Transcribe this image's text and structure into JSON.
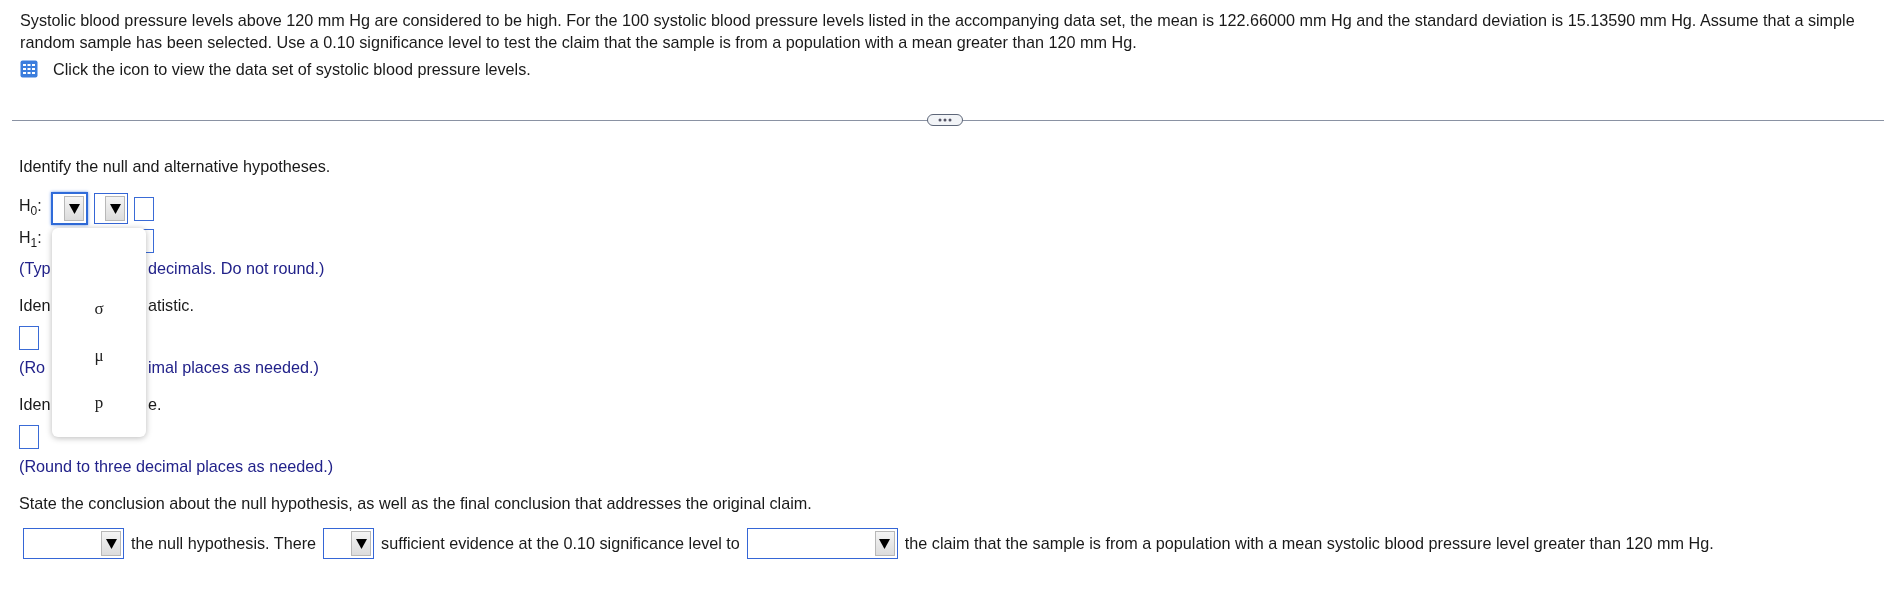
{
  "problem": {
    "text": "Systolic blood pressure levels above 120 mm Hg are considered to be high. For the 100 systolic blood pressure levels listed in the accompanying data set, the mean is 122.66000 mm Hg and the standard deviation is 15.13590 mm Hg. Assume that a simple random sample has been selected. Use a 0.10 significance level to test the claim that the sample is from a population with a mean greater than 120 mm Hg.",
    "data_hint": "Click the icon to view the data set of systolic blood pressure levels."
  },
  "hypotheses": {
    "prompt": "Identify the null and alternative hypotheses.",
    "rows": [
      {
        "label": "H$_{0}$:",
        "dropdowns": [
          {
            "expanded": true,
            "options": [
              "σ",
              "μ",
              "p"
            ]
          },
          {
            "expanded": false
          }
        ]
      },
      {
        "label": "H$_{1}$:"
      }
    ]
  },
  "steps": [
    {
      "kind": "note",
      "text": [
        "(Typ",
        "decimals. Do not round.)"
      ]
    },
    {
      "kind": "prompt",
      "text": [
        "Iden",
        "atistic."
      ]
    },
    {
      "kind": "answer_box"
    },
    {
      "kind": "note",
      "text": [
        "(Ro",
        "imal places as needed.)"
      ]
    },
    {
      "kind": "prompt",
      "text": [
        "Iden",
        "e."
      ]
    },
    {
      "kind": "answer_box"
    },
    {
      "kind": "note",
      "text": [
        "(Round to three decimal places as needed.)"
      ]
    },
    {
      "kind": "prompt",
      "text": [
        "State the conclusion about the null hypothesis, as well as the final conclusion that addresses the original claim."
      ]
    }
  ],
  "conclusion": [
    {
      "kind": "dropdown"
    },
    {
      "kind": "text",
      "text": "the null hypothesis. There"
    },
    {
      "kind": "dropdown"
    },
    {
      "kind": "text",
      "text": "sufficient evidence at the 0.10 significance level to"
    },
    {
      "kind": "dropdown"
    },
    {
      "kind": "text",
      "text": "the claim that the sample is from a population with a mean systolic blood pressure level greater than 120 mm Hg."
    }
  ]
}
